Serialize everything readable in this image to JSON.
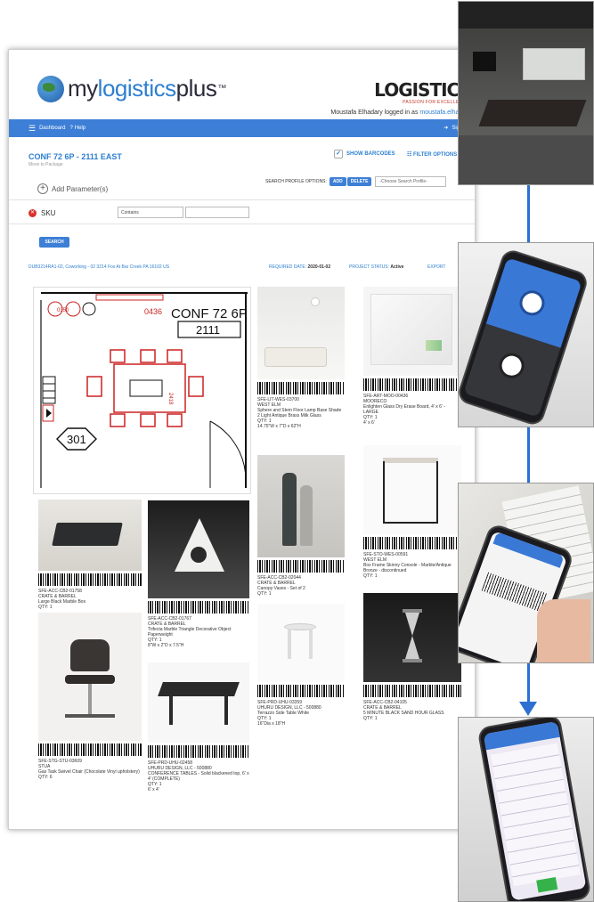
{
  "header": {
    "logo_prefix": "my",
    "logo_mid": "logistics",
    "logo_suffix": "plus",
    "logo_tm": "™",
    "brand2": "LOGISTICS",
    "brand2_tagline": "PASSION FOR EXCELLENCE",
    "logged_in_text": "Moustafa Elhadary logged in as ",
    "logged_in_user": "moustafa.elhadary"
  },
  "navbar": {
    "dashboard": "Dashboard",
    "help": "Help",
    "signout": "Sign Ou"
  },
  "project": {
    "title": "CONF 72 6P - 2111 EAST",
    "subtitle": "Move to Package",
    "show_barcodes": "SHOW BARCODES",
    "filter_options": "FILTER OPTIONS"
  },
  "search_profile": {
    "label": "SEARCH PROFILE OPTIONS:",
    "add": "ADD",
    "delete": "DELETE",
    "select_placeholder": "-Choose Search Profile-"
  },
  "filters": {
    "add_parameter": "Add Parameter(s)",
    "sku_label": "SKU",
    "operator": "Contains",
    "search_button": "SEARCH"
  },
  "info": {
    "address": "DUB3214RA1-02, Coworking - 02 3214 Fox At Bar Creek PA 16102 US",
    "required_date_label": "REQUIRED DATE:",
    "required_date": "2020-01-02",
    "status_label": "PROJECT STATUS:",
    "status": "Active",
    "export": "EXPORT"
  },
  "floor_plan": {
    "room_name": "CONF 72 6P",
    "room_number": "2111",
    "tag_left": "0436",
    "tag_mid": "0350",
    "hex_label": "301",
    "dim": "2418"
  },
  "products": [
    {
      "sku": "SFE-LIT-WES-03700",
      "vendor": "WEST ELM",
      "desc": "Sphere and Stem Floor Lamp Base Shade 2 Light Antique Brass Milk Glass",
      "qty": "QTY: 1",
      "size": "14.75\"W x 7\"D x 62\"H"
    },
    {
      "sku": "SFE-ART-MOO-00436",
      "vendor": "MOORECO",
      "desc": "Enlighten Glass Dry Erase Board, 4' x 6' - LARGE",
      "qty": "QTY: 1",
      "size": "4' x 6'"
    },
    {
      "sku": "SFE-ACC-CB2-02044",
      "vendor": "CRATE & BARREL",
      "desc": "Canopy Vases - Set of 2",
      "qty": "QTY: 1",
      "size": ""
    },
    {
      "sku": "SFE-STO-WES-00591",
      "vendor": "WEST ELM",
      "desc": "Box Frame Skinny Console - Marble/Antique Bronze - discontinued",
      "qty": "QTY: 1",
      "size": ""
    },
    {
      "sku": "SFE-ACC-CB2-01758",
      "vendor": "CRATE & BARREL",
      "desc": "Large Black Marble Box",
      "qty": "QTY: 1",
      "size": ""
    },
    {
      "sku": "SFE-ACC-CB2-01767",
      "vendor": "CRATE & BARREL",
      "desc": "Trifecta Marble Triangle Decorative Object Paperweight",
      "qty": "QTY: 1",
      "size": "8\"W x 2\"D x 7.5\"H"
    },
    {
      "sku": "SFE-PRD-UHU-03359",
      "vendor": "UHURU DESIGN, LLC - 500880",
      "desc": "Terrazzo Side Table White",
      "qty": "QTY: 1",
      "size": "16\"Dia x 18\"H"
    },
    {
      "sku": "SFE-ACC-CB2-04105",
      "vendor": "CRATE & BARREL",
      "desc": "5 MINUTE BLACK SAND HOUR GLASS",
      "qty": "QTY: 1",
      "size": ""
    },
    {
      "sku": "SFE-STG-STU-03609",
      "vendor": "STUA",
      "desc": "Gas Task Swivel Chair (Chocolate Vinyl upholstery)",
      "qty": "QTY: 6",
      "size": ""
    },
    {
      "sku": "SFE-PRD-UHU-02458",
      "vendor": "UHURU DESIGN, LLC - 500880",
      "desc": "CONFERENCE TABLES - Solid blackened top, 6' x 4' (COMPLETE)",
      "qty": "QTY: 1",
      "size": "6' x 4'"
    }
  ],
  "colors": {
    "accent": "#3d7fd6",
    "link": "#2e7fd0",
    "danger": "#d8322a",
    "flow_arrow": "#2e6fd2"
  }
}
